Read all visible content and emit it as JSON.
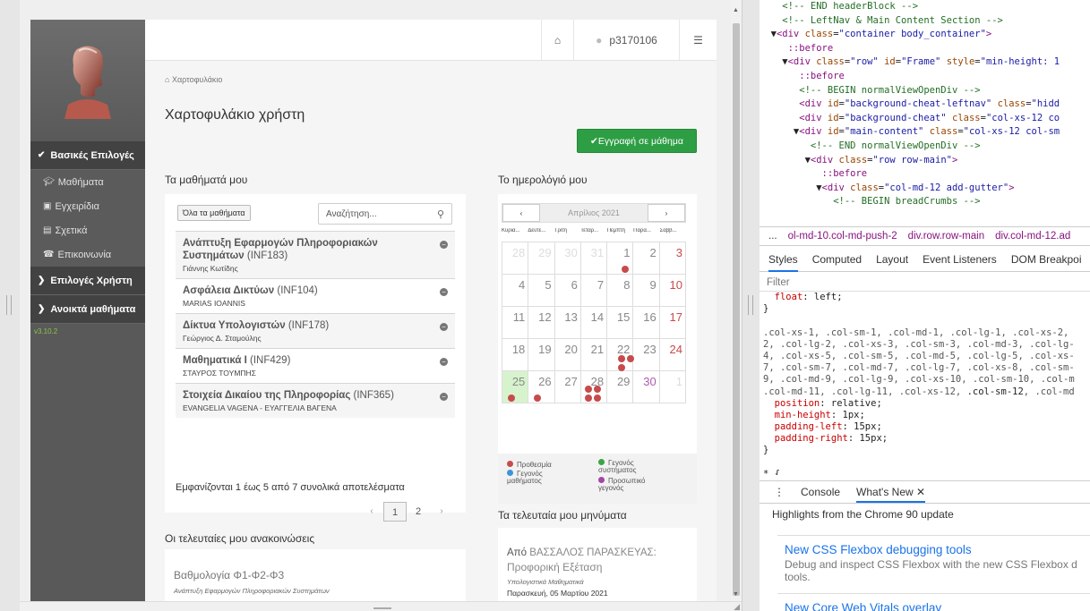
{
  "app": {
    "user": "p3170106",
    "breadcrumb": "Χαρτοφυλάκιο",
    "title": "Χαρτοφυλάκιο χρήστη",
    "enroll_label": "Εγγραφή σε μάθημα",
    "version": "v3.10.2"
  },
  "sidebar": {
    "group_basic": "Βασικές Επιλογές",
    "items": [
      {
        "label": "Μαθήματα",
        "icon": "graduation-cap-icon"
      },
      {
        "label": "Εγχειρίδια",
        "icon": "document-icon"
      },
      {
        "label": "Σχετικά",
        "icon": "window-icon"
      },
      {
        "label": "Επικοινωνία",
        "icon": "phone-icon"
      }
    ],
    "group_user": "Επιλογές Χρήστη",
    "group_open": "Ανοικτά μαθήματα"
  },
  "courses": {
    "section_title": "Τα μαθήματά μου",
    "all_button": "Όλα τα μαθήματα",
    "search_placeholder": "Αναζήτηση...",
    "list": [
      {
        "name": "Ανάπτυξη Εφαρμογών Πληροφοριακών Συστημάτων",
        "code": "(INF183)",
        "teacher": "Γιάννης Κωτίδης"
      },
      {
        "name": "Ασφάλεια Δικτύων",
        "code": "(INF104)",
        "teacher": "MARIAS IOANNIS"
      },
      {
        "name": "Δίκτυα Υπολογιστών",
        "code": "(INF178)",
        "teacher": "Γεώργιος Δ. Σταμούλης"
      },
      {
        "name": "Μαθηματικά Ι",
        "code": "(INF429)",
        "teacher": "ΣΤΑΥΡΟΣ ΤΟΥΜΠΗΣ"
      },
      {
        "name": "Στοιχεία Δικαίου της Πληροφορίας",
        "code": "(INF365)",
        "teacher": "EVANGELIA VAGENA - ΕΥΑΓΓΕΛΙΑ ΒΑΓΕΝΑ"
      }
    ],
    "results_text": "Εμφανίζονται 1 έως 5 από 7 συνολικά αποτελέσματα",
    "pages": [
      "1",
      "2"
    ],
    "prev": "‹",
    "next": "›"
  },
  "calendar": {
    "section_title": "Το ημερολόγιό μου",
    "month": "Απρίλιος 2021",
    "prev": "‹",
    "next": "›",
    "dows": [
      "Κυρια...",
      "Δευτέ...",
      "Τρίτη",
      "Τετάρ...",
      "Πέμπτη",
      "Παρα...",
      "Σάββ..."
    ],
    "weeks": [
      [
        "28",
        "29",
        "30",
        "31",
        "1",
        "2",
        "3"
      ],
      [
        "4",
        "5",
        "6",
        "7",
        "8",
        "9",
        "10"
      ],
      [
        "11",
        "12",
        "13",
        "14",
        "15",
        "16",
        "17"
      ],
      [
        "18",
        "19",
        "20",
        "21",
        "22",
        "23",
        "24"
      ],
      [
        "25",
        "26",
        "27",
        "28",
        "29",
        "30",
        "1"
      ]
    ],
    "legend": {
      "deadline": "Προθεσμία",
      "system_event": "Γεγονός συστήματος",
      "course_event": "Γεγονός μαθήματος",
      "personal_event": "Προσωπικό γεγονός"
    },
    "colors": {
      "deadline": "#c74b4b",
      "system": "#3aa541",
      "course": "#3d94d9",
      "personal": "#a446a4"
    }
  },
  "messages": {
    "section_title": "Τα τελευταία μου μηνύματα",
    "from_prefix": "Από",
    "from_name": "ΒΑΣΣΑΛΟΣ ΠΑΡΑΣΚΕΥΑΣ:",
    "subject": "Προφορική Εξέταση",
    "course": "Υπολογιστικά Μαθηματικά",
    "date": "Παρασκευή, 05 Μαρτίου 2021"
  },
  "announcements": {
    "section_title": "Οι τελευταίες μου ανακοινώσεις",
    "title": "Βαθμολογία Φ1-Φ2-Φ3",
    "course": "Ανάπτυξη Εφαρμογών Πληροφοριακών Συστημάτων"
  },
  "devtools": {
    "crumbs": [
      "...",
      "ol-md-10.col-md-push-2",
      "div.row.row-main",
      "div.col-md-12.ad"
    ],
    "style_tabs": [
      "Styles",
      "Computed",
      "Layout",
      "Event Listeners",
      "DOM Breakpoi"
    ],
    "filter_placeholder": "Filter",
    "drawer_tabs": [
      "Console",
      "What's New"
    ],
    "highlights": "Highlights from the Chrome 90 update",
    "news": [
      {
        "title": "New CSS Flexbox debugging tools",
        "desc": "Debug and inspect CSS Flexbox with the new CSS Flexbox d tools."
      },
      {
        "title": "New Core Web Vitals overlay",
        "desc": ""
      }
    ]
  }
}
